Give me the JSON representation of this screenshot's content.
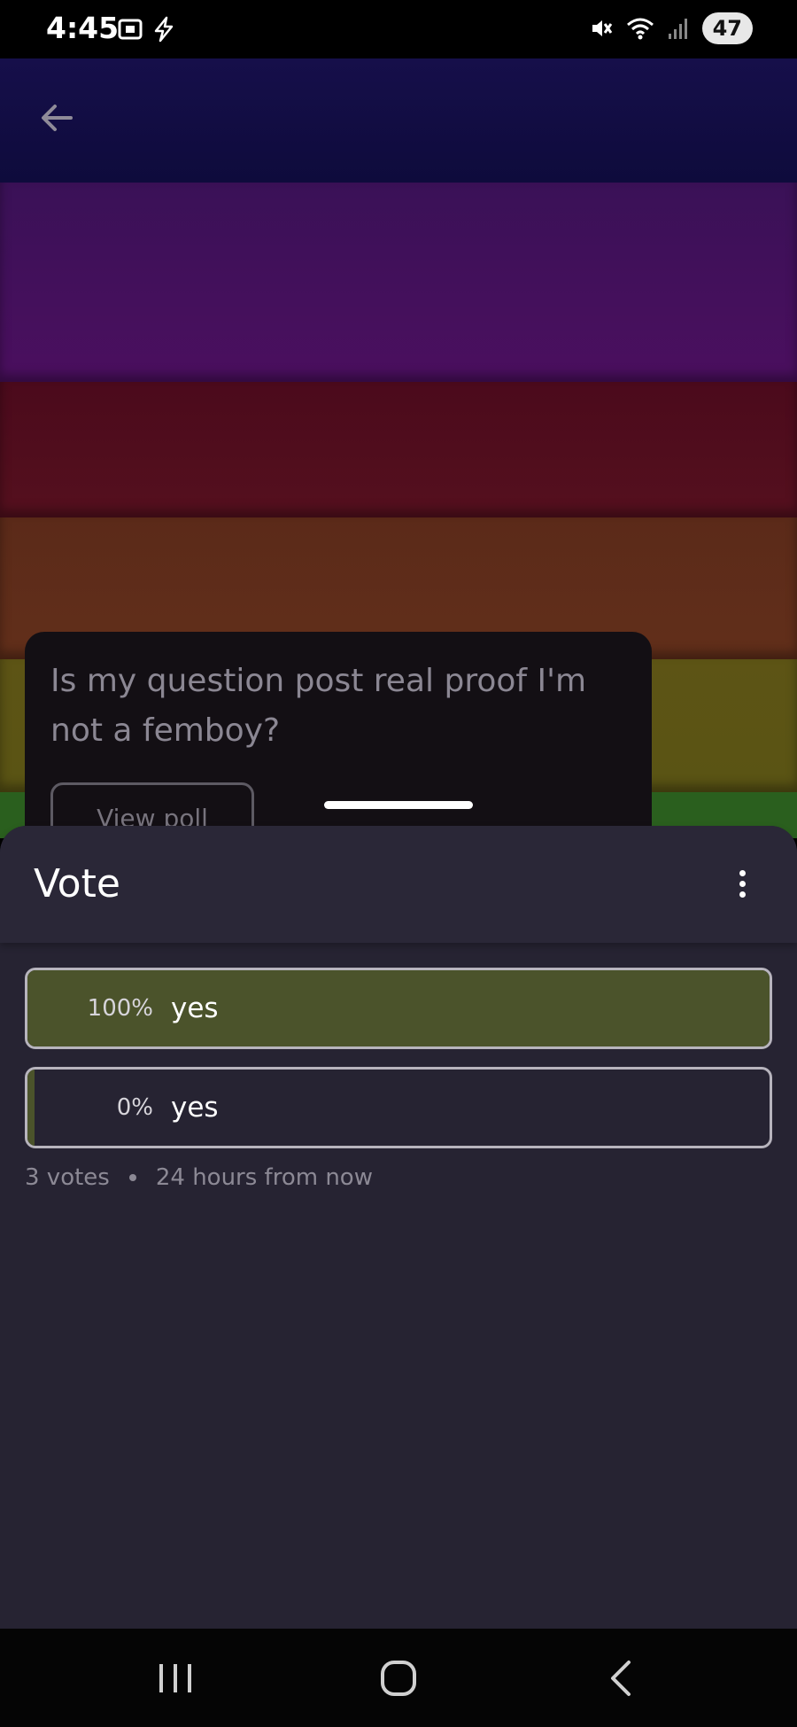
{
  "status_bar": {
    "time": "4:45",
    "battery": "47",
    "icons": [
      "screenshot-icon",
      "flash-icon",
      "mute-icon",
      "wifi-icon",
      "signal-icon"
    ]
  },
  "background": {
    "stripe_colors": [
      "#160f4a",
      "#3a1157",
      "#4b0a1c",
      "#5b2a19",
      "#5d5414",
      "#2a5f1e"
    ]
  },
  "post": {
    "question": "Is my question post real proof I'm not a femboy?",
    "view_poll_label": "View poll"
  },
  "sheet": {
    "title": "Vote",
    "options": [
      {
        "percent_label": "100%",
        "label": "yes",
        "share": 1.0
      },
      {
        "percent_label": "0%",
        "label": "yes",
        "share": 0.0
      }
    ],
    "votes": "3 votes",
    "time_remaining": "24 hours from now"
  },
  "colors": {
    "sheet_bg": "#262332",
    "winning_fill": "#4b532b",
    "option_border": "#b7b4bd"
  }
}
